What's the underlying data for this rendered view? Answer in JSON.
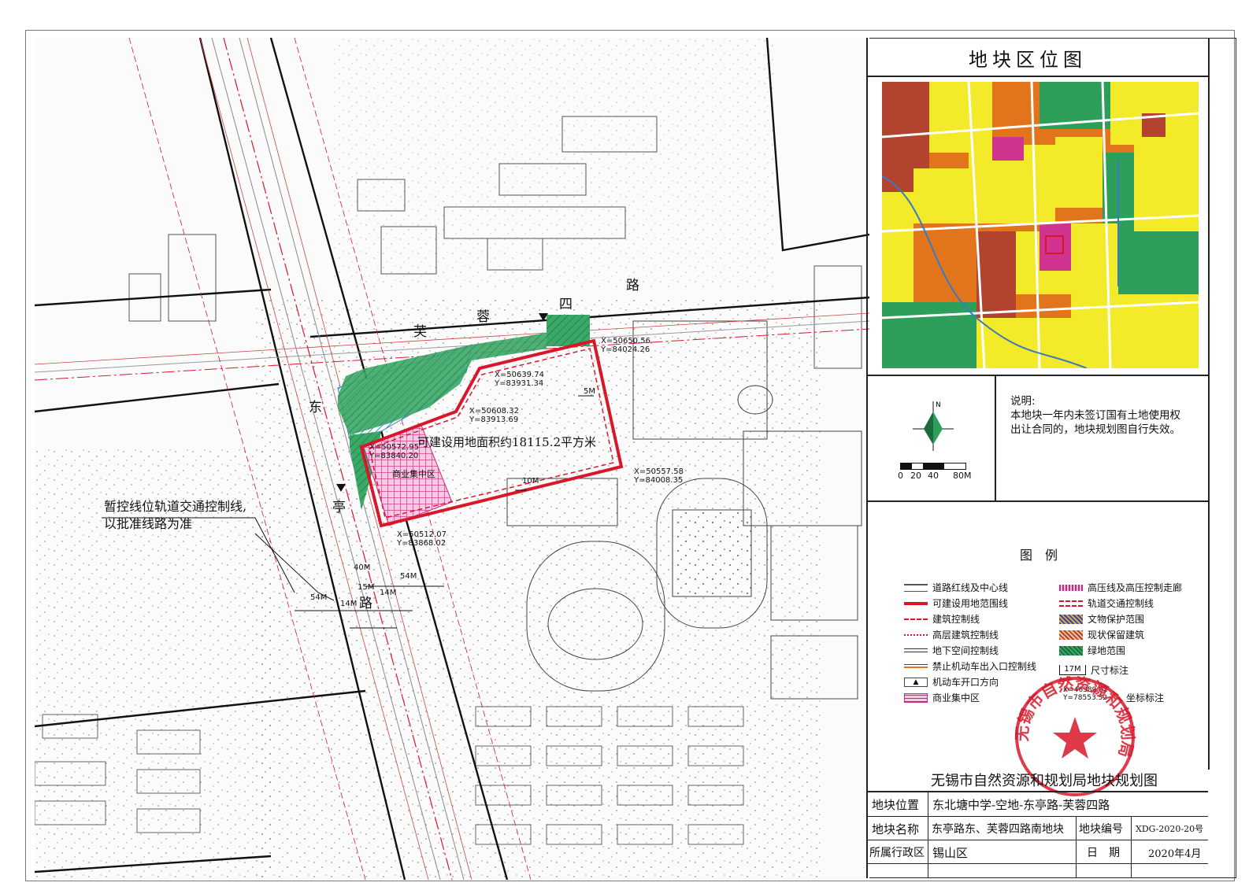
{
  "panel": {
    "locator_title": "地块区位图",
    "note_label": "说明:",
    "note_text": "本地块一年内未签订国有土地使用权出让合同的，地块规划图自行失效。",
    "scale_ticks": [
      "0",
      "20",
      "40",
      "80M"
    ],
    "legend_title": "图　例"
  },
  "legend": [
    {
      "label": "道路红线及中心线",
      "icon": "road-redline-icon"
    },
    {
      "label": "可建设用地范围线",
      "icon": "buildable-boundary-icon"
    },
    {
      "label": "建筑控制线",
      "icon": "building-control-icon"
    },
    {
      "label": "高层建筑控制线",
      "icon": "highrise-control-icon"
    },
    {
      "label": "地下空间控制线",
      "icon": "underground-control-icon"
    },
    {
      "label": "禁止机动车出入口控制线",
      "icon": "no-vehicle-entry-icon"
    },
    {
      "label": "机动车开口方向",
      "icon": "vehicle-entry-arrow-icon"
    },
    {
      "label": "商业集中区",
      "icon": "commercial-zone-icon"
    },
    {
      "label": "高压线及高压控制走廊",
      "icon": "high-voltage-icon"
    },
    {
      "label": "轨道交通控制线",
      "icon": "rail-control-icon"
    },
    {
      "label": "文物保护范围",
      "icon": "heritage-icon"
    },
    {
      "label": "现状保留建筑",
      "icon": "retained-building-icon"
    },
    {
      "label": "绿地范围",
      "icon": "green-area-icon"
    },
    {
      "label": "尺寸标注",
      "icon": "dimension-icon",
      "sample": "17M"
    },
    {
      "label": "坐标标注",
      "icon": "coordinate-icon",
      "sample_x": "X=46389.92",
      "sample_y": "Y=78553.32"
    }
  ],
  "titleblock": {
    "title": "无锡市自然资源和规划局地块规划图",
    "loc_label": "地块位置",
    "loc_value": "东北塘中学-空地-东亭路-芙蓉四路",
    "name_label": "地块名称",
    "name_value": "东亭路东、芙蓉四路南地块",
    "code_label": "地块编号",
    "code_value": "XDG-2020-20号",
    "district_label": "所属行政区",
    "district_value": "锡山区",
    "date_label": "日　期",
    "date_value": "2020年4月"
  },
  "stamp": {
    "text": "无锡市自然资源和规划局"
  },
  "map": {
    "road_names": [
      "芙",
      "蓉",
      "四",
      "路",
      "东",
      "亭",
      "路"
    ],
    "area_label": "可建设用地面积约18115.2平方米",
    "commercial_label": "商业集中区",
    "rail_note_1": "暂控线位轨道交通控制线,",
    "rail_note_2": "以批准线路为准",
    "coords": [
      {
        "x": "X=50639.74",
        "y": "Y=83931.34"
      },
      {
        "x": "X=50650.56",
        "y": "Y=84024.26"
      },
      {
        "x": "X=50608.32",
        "y": "Y=83913.69"
      },
      {
        "x": "X=50572.95",
        "y": "Y=83840.20"
      },
      {
        "x": "X=50557.58",
        "y": "Y=84008.35"
      },
      {
        "x": "X=50512.07",
        "y": "Y=83868.02"
      }
    ],
    "dims": [
      "5M",
      "10M",
      "54M",
      "40M",
      "15M",
      "14M",
      "54M",
      "14M"
    ]
  },
  "colors": {
    "redline": "#d8182a",
    "green": "#2e9e5b",
    "blue": "#4aa3df",
    "magenta": "#d0348f",
    "yellow": "#f3ea2a",
    "orange": "#e2741c",
    "brown": "#b2432e"
  }
}
